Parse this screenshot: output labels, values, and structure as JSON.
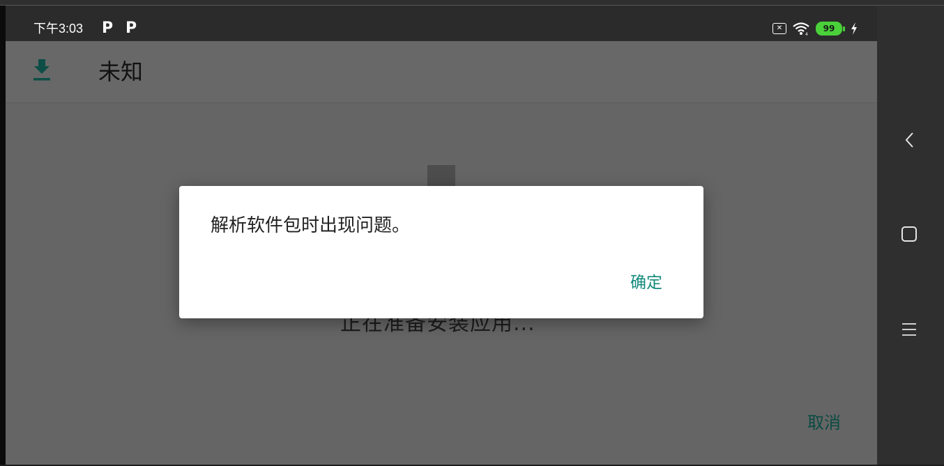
{
  "status_bar": {
    "time": "下午3:03",
    "notification_icons": [
      "P",
      "P"
    ],
    "battery_level": "99",
    "icons": [
      "no-sim-icon",
      "wifi-icon",
      "battery-icon",
      "charging-icon"
    ]
  },
  "app_bar": {
    "icon": "download-icon",
    "title": "未知"
  },
  "background": {
    "progress_text": "正在准备安装应用...",
    "cancel_label": "取消"
  },
  "dialog": {
    "message": "解析软件包时出现问题。",
    "ok_label": "确定"
  },
  "navigation": {
    "items": [
      "back-icon",
      "home-icon",
      "menu-icon"
    ]
  },
  "colors": {
    "accent": "#138a7c",
    "accent_dim": "#0b4b43",
    "scrim": "#656565",
    "status_bar": "#2b2b2b",
    "battery": "#4ad13a"
  }
}
